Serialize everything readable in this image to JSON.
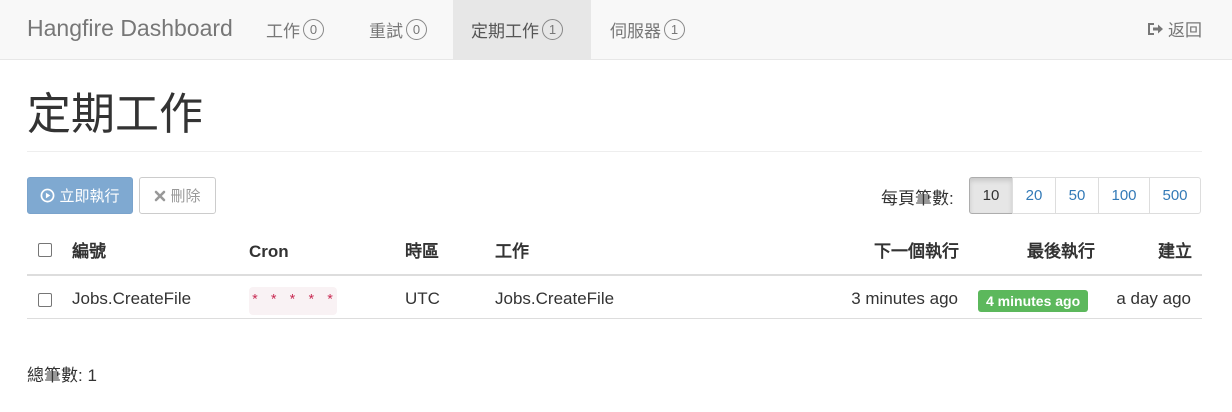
{
  "navbar": {
    "brand": "Hangfire Dashboard",
    "items": [
      {
        "label": "工作",
        "count": "0",
        "active": false
      },
      {
        "label": "重試",
        "count": "0",
        "active": false
      },
      {
        "label": "定期工作",
        "count": "1",
        "active": true
      },
      {
        "label": "伺服器",
        "count": "1",
        "active": false
      }
    ],
    "back_label": "返回",
    "back_icon": "sign-out-icon"
  },
  "page": {
    "title": "定期工作"
  },
  "toolbar": {
    "trigger_label": "立即執行",
    "trigger_icon": "play-circle-icon",
    "delete_label": "刪除",
    "delete_icon": "close-icon",
    "page_size_label": "每頁筆數:",
    "page_sizes": [
      "10",
      "20",
      "50",
      "100",
      "500"
    ],
    "page_size_selected": "10"
  },
  "table": {
    "headers": {
      "id": "編號",
      "cron": "Cron",
      "timezone": "時區",
      "job": "工作",
      "next_execution": "下一個執行",
      "last_execution": "最後執行",
      "created": "建立"
    },
    "rows": [
      {
        "id": "Jobs.CreateFile",
        "cron": "* * * * *",
        "timezone": "UTC",
        "job": "Jobs.CreateFile",
        "next_execution": "3 minutes ago",
        "last_execution": "4 minutes ago",
        "created": "a day ago"
      }
    ]
  },
  "footer": {
    "total": "總筆數: 1"
  },
  "colors": {
    "primary_button": "#7fa9d1",
    "success_label": "#5cb85c",
    "code_text": "#c7254e",
    "code_bg": "#f9f2f4",
    "link": "#337ab7"
  }
}
